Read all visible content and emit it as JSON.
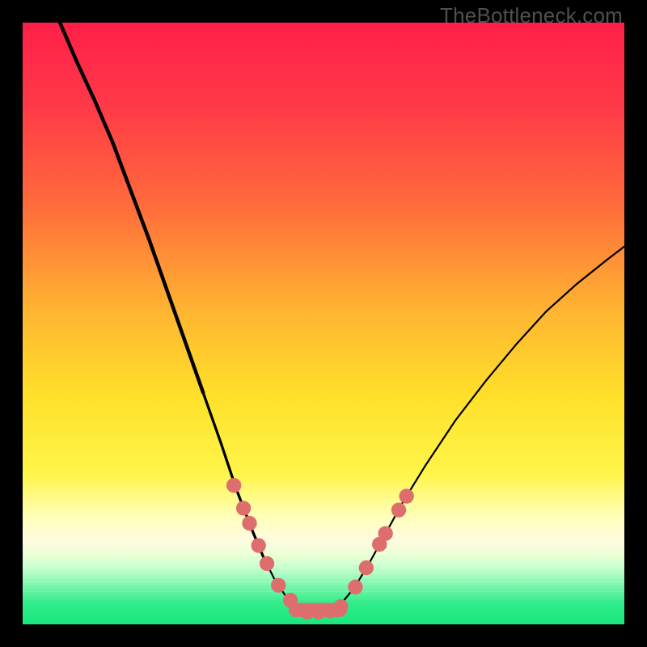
{
  "watermark": "TheBottleneck.com",
  "chart_data": {
    "type": "line",
    "title": "",
    "xlabel": "",
    "ylabel": "",
    "xlim": [
      0,
      1
    ],
    "ylim": [
      0,
      1
    ],
    "background_gradient": {
      "top": "#ff1f49",
      "mid1": "#ff7a3a",
      "mid2": "#ffd22e",
      "band_light": "#ffffb8",
      "bottom": "#18e77e"
    },
    "series": [
      {
        "name": "left-curve",
        "stroke": "#000000",
        "points": [
          {
            "x": 0.062,
            "y": 1.0
          },
          {
            "x": 0.09,
            "y": 0.935
          },
          {
            "x": 0.12,
            "y": 0.87
          },
          {
            "x": 0.15,
            "y": 0.8
          },
          {
            "x": 0.18,
            "y": 0.72
          },
          {
            "x": 0.21,
            "y": 0.64
          },
          {
            "x": 0.24,
            "y": 0.555
          },
          {
            "x": 0.27,
            "y": 0.47
          },
          {
            "x": 0.3,
            "y": 0.385
          },
          {
            "x": 0.33,
            "y": 0.3
          },
          {
            "x": 0.355,
            "y": 0.225
          },
          {
            "x": 0.38,
            "y": 0.16
          },
          {
            "x": 0.4,
            "y": 0.112
          },
          {
            "x": 0.42,
            "y": 0.072
          },
          {
            "x": 0.44,
            "y": 0.043
          },
          {
            "x": 0.462,
            "y": 0.025
          },
          {
            "x": 0.485,
            "y": 0.02
          }
        ]
      },
      {
        "name": "right-curve",
        "stroke": "#000000",
        "points": [
          {
            "x": 0.485,
            "y": 0.02
          },
          {
            "x": 0.51,
            "y": 0.022
          },
          {
            "x": 0.53,
            "y": 0.035
          },
          {
            "x": 0.552,
            "y": 0.062
          },
          {
            "x": 0.575,
            "y": 0.1
          },
          {
            "x": 0.6,
            "y": 0.145
          },
          {
            "x": 0.63,
            "y": 0.2
          },
          {
            "x": 0.67,
            "y": 0.265
          },
          {
            "x": 0.72,
            "y": 0.34
          },
          {
            "x": 0.77,
            "y": 0.405
          },
          {
            "x": 0.82,
            "y": 0.465
          },
          {
            "x": 0.87,
            "y": 0.52
          },
          {
            "x": 0.92,
            "y": 0.565
          },
          {
            "x": 0.97,
            "y": 0.605
          },
          {
            "x": 1.0,
            "y": 0.628
          }
        ]
      }
    ],
    "markers": {
      "color": "#de6e6e",
      "radius": 0.013,
      "points_left": [
        {
          "x": 0.351,
          "y": 0.231
        },
        {
          "x": 0.367,
          "y": 0.193
        },
        {
          "x": 0.377,
          "y": 0.168
        },
        {
          "x": 0.392,
          "y": 0.131
        },
        {
          "x": 0.406,
          "y": 0.101
        },
        {
          "x": 0.425,
          "y": 0.065
        },
        {
          "x": 0.445,
          "y": 0.04
        }
      ],
      "points_bottom": [
        {
          "x": 0.454,
          "y": 0.024
        },
        {
          "x": 0.473,
          "y": 0.02
        },
        {
          "x": 0.492,
          "y": 0.02
        },
        {
          "x": 0.511,
          "y": 0.022
        },
        {
          "x": 0.529,
          "y": 0.03
        }
      ],
      "points_right": [
        {
          "x": 0.553,
          "y": 0.062
        },
        {
          "x": 0.571,
          "y": 0.094
        },
        {
          "x": 0.593,
          "y": 0.133
        },
        {
          "x": 0.603,
          "y": 0.151
        },
        {
          "x": 0.625,
          "y": 0.19
        },
        {
          "x": 0.638,
          "y": 0.213
        }
      ]
    }
  }
}
